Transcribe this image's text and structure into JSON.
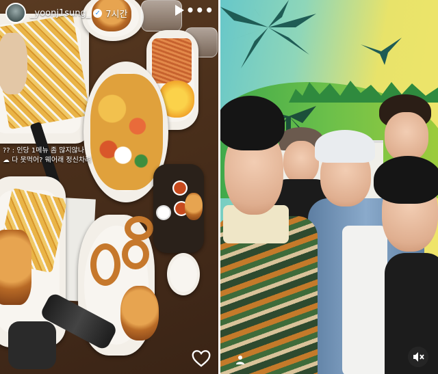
{
  "story": {
    "username": "_yoonj1sung_",
    "verified_mark": "✓",
    "timestamp": "7시간",
    "more_glyph": "•••",
    "caption": {
      "line1": "?? : 인당 1메뉴 좀 많지않나",
      "line2": "☁ 다 못먹어? 웨어래 정신차려"
    }
  },
  "icons": {
    "play": "play-icon",
    "more": "more-options-icon",
    "heart": "heart-outline-icon",
    "profile": "person-icon",
    "mute": "speaker-muted-icon",
    "verified": "verified-badge-icon"
  },
  "colors": {
    "verified_blue": "#3897f0",
    "overlay_text": "#ffffff",
    "divider": "#ffffff"
  }
}
